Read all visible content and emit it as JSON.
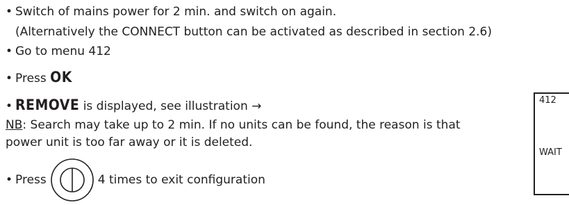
{
  "steps": [
    {
      "bullet": "•",
      "text": "Switch of mains power for 2 min. and switch on again."
    },
    {
      "text": "(Alternatively the CONNECT button can be activated as described in section 2.6)"
    },
    {
      "bullet": "•",
      "text": "Go to menu 412"
    },
    {
      "bullet": "•",
      "prefix": "Press ",
      "strong": "OK"
    },
    {
      "bullet": "•",
      "strong": "REMOVE",
      "suffix": " is displayed, see illustration →"
    },
    {
      "nb_label": "NB",
      "text": ": Search may take up to 2 min. If no units can be found, the reason is that"
    },
    {
      "text": "power unit is too far away or it is deleted."
    },
    {
      "bullet": "•",
      "prefix": "Press",
      "suffix": "4 times to exit configuration"
    }
  ],
  "illustration": {
    "menu_number": "412",
    "status_text": "WAIT"
  },
  "icons": {
    "power_button": "power-button-icon"
  }
}
